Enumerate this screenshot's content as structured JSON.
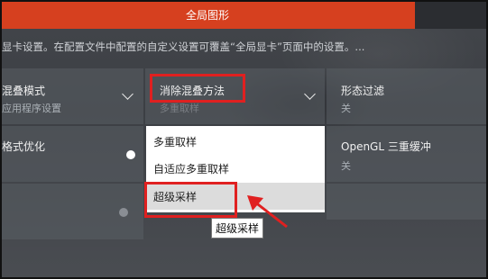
{
  "header": {
    "active_tab": "全局图形"
  },
  "info_text": "显卡设置。在配置文件中配置的自定义设置可覆盖“全局显卡”页面中的设置。...",
  "settings": {
    "aa_mode": {
      "label": "混叠模式",
      "value": "应用程序设置"
    },
    "aa_method": {
      "label": "消除混叠方法",
      "value": "多重取样"
    },
    "morph_filter": {
      "label": "形态过滤",
      "value": "关"
    },
    "format_opt": {
      "label": "格式优化"
    },
    "opengl_triple": {
      "label": "OpenGL 三重缓冲",
      "value": "关"
    }
  },
  "dropdown": {
    "options": [
      "多重取样",
      "自适应多重取样",
      "超级采样"
    ],
    "hovered_index": 2
  },
  "tooltip": {
    "text": "超级采样"
  },
  "colors": {
    "accent": "#d6401f",
    "highlight": "#e02020"
  }
}
